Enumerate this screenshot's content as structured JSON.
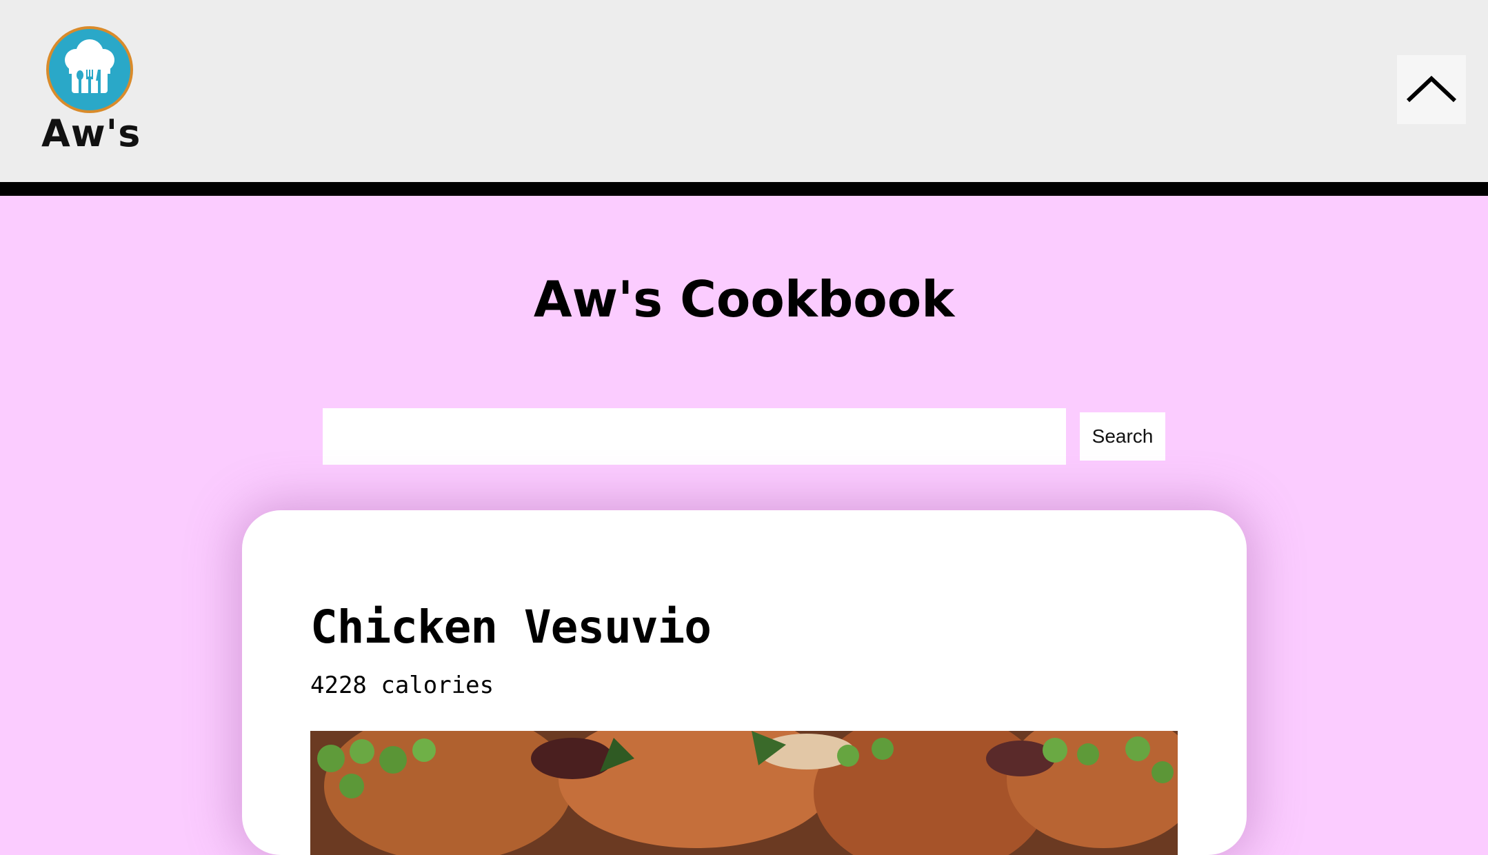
{
  "header": {
    "logo_text": "Aw's",
    "scroll_top_icon": "chevron-up-icon"
  },
  "main": {
    "title": "Aw's Cookbook",
    "search": {
      "value": "",
      "placeholder": "",
      "button_label": "Search"
    }
  },
  "recipes": [
    {
      "title": "Chicken Vesuvio",
      "calories": "4228 calories",
      "image": "chicken-vesuvio-photo"
    }
  ],
  "colors": {
    "page_background": "#fbccff",
    "header_background": "#ededed",
    "header_border": "#000000",
    "logo_circle": "#2aa8c8",
    "logo_ring": "#d98b2b",
    "card_background": "#ffffff"
  }
}
